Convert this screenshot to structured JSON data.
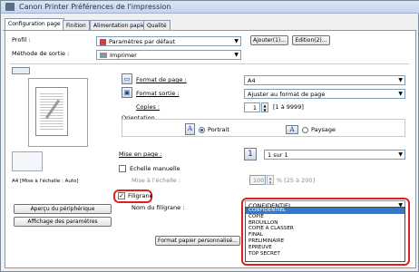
{
  "window": {
    "title": "Canon Printer Préférences de l'impression"
  },
  "tabs": [
    "Configuration page",
    "Finition",
    "Alimentation papier",
    "Qualité"
  ],
  "profile": {
    "label": "Profil :",
    "value": "Paramètres par défaut",
    "add_button": "Ajouter(1)...",
    "edit_button": "Edition(2)..."
  },
  "output_method": {
    "label": "Méthode de sortie :",
    "value": "Imprimer"
  },
  "preview": {
    "caption": "A4 [Mise à l'échelle : Auto]"
  },
  "page_format": {
    "label": "Format de page :",
    "value": "A4"
  },
  "output_format": {
    "label": "Format sortie :",
    "value": "Ajuster au format de page"
  },
  "copies": {
    "label": "Copies :",
    "value": "1",
    "range": "[1 à 9999]"
  },
  "orientation": {
    "label": "Orientation",
    "portrait_label": "Portrait",
    "landscape_label": "Paysage",
    "selected": "Portrait"
  },
  "layout": {
    "label": "Mise en page :",
    "value": "1 sur 1"
  },
  "scaling": {
    "checkbox_label": "Echelle manuelle",
    "scale_label": "Mise à l'échelle :",
    "scale_value": "100",
    "scale_range": "% [25 à 200]"
  },
  "watermark": {
    "checkbox_label": "Filigrane",
    "checked": true,
    "name_label": "Nom du filigrane :",
    "value": "CONFIDENTIEL",
    "options": [
      "CONFIDENTIEL",
      "COPIE",
      "BROUILLON",
      "COPIE A CLASSER",
      "FINAL",
      "PRELIMINAIRE",
      "EPREUVE",
      "TOP SECRET"
    ],
    "selected_index": 0
  },
  "left_buttons": {
    "preview_button": "Aperçu du périphérique",
    "params_button": "Affichage des paramètres"
  },
  "custom_paper_button": "Format papier personnalisé...",
  "colors": {
    "highlight": "#e02020",
    "selection": "#3078d0"
  }
}
